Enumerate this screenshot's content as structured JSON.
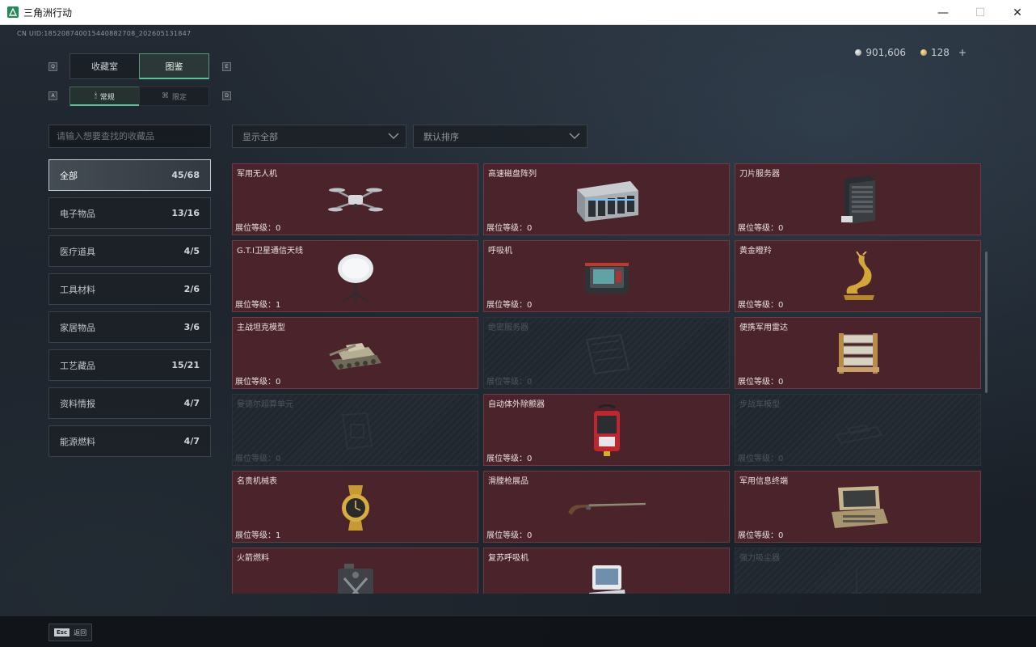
{
  "window": {
    "title": "三角洲行动",
    "minimize": "—",
    "maximize": "☐",
    "close": "✕"
  },
  "header": {
    "uid": "CN UID:18520874001544088270​8_202605131847",
    "silver": "901,606",
    "gold": "128",
    "plus": "+"
  },
  "tabs": {
    "left_key": "Q",
    "right_key": "E",
    "items": [
      {
        "label": "收藏室",
        "active": false
      },
      {
        "label": "图鉴",
        "active": true
      }
    ]
  },
  "subtabs": {
    "left_key": "A",
    "right_key": "D",
    "items": [
      {
        "label": "常规",
        "active": true
      },
      {
        "label": "限定",
        "active": false
      }
    ]
  },
  "search": {
    "placeholder": "请输入想要查找的收藏品"
  },
  "filters": {
    "show": "显示全部",
    "sort": "默认排序"
  },
  "categories": [
    {
      "label": "全部",
      "count": "45/68",
      "active": true
    },
    {
      "label": "电子物品",
      "count": "13/16",
      "active": false
    },
    {
      "label": "医疗道具",
      "count": "4/5",
      "active": false
    },
    {
      "label": "工具材料",
      "count": "2/6",
      "active": false
    },
    {
      "label": "家居物品",
      "count": "3/6",
      "active": false
    },
    {
      "label": "工艺藏品",
      "count": "15/21",
      "active": false
    },
    {
      "label": "资料情报",
      "count": "4/7",
      "active": false
    },
    {
      "label": "能源燃料",
      "count": "4/7",
      "active": false
    }
  ],
  "items": [
    {
      "name": "军用无人机",
      "level": "展位等级：0",
      "locked": false,
      "icon": "drone-icon"
    },
    {
      "name": "高速磁盘阵列",
      "level": "展位等级：0",
      "locked": false,
      "icon": "disk-array-icon"
    },
    {
      "name": "刀片服务器",
      "level": "展位等级：0",
      "locked": false,
      "icon": "blade-server-icon"
    },
    {
      "name": "G.T.I卫星通信天线",
      "level": "展位等级：1",
      "locked": false,
      "icon": "satellite-dish-icon"
    },
    {
      "name": "呼吸机",
      "level": "展位等级：0",
      "locked": false,
      "icon": "ventilator-icon"
    },
    {
      "name": "黄金瞪羚",
      "level": "展位等级：0",
      "locked": false,
      "icon": "gold-gazelle-icon"
    },
    {
      "name": "主战坦克模型",
      "level": "展位等级：0",
      "locked": false,
      "icon": "tank-model-icon"
    },
    {
      "name": "绝密服务器",
      "level": "展位等级：0",
      "locked": true,
      "icon": "server-icon"
    },
    {
      "name": "便携军用雷达",
      "level": "展位等级：0",
      "locked": false,
      "icon": "radar-icon"
    },
    {
      "name": "曼德尔超算单元",
      "level": "展位等级：0",
      "locked": true,
      "icon": "compute-unit-icon"
    },
    {
      "name": "自动体外除颤器",
      "level": "展位等级：0",
      "locked": false,
      "icon": "defibrillator-icon"
    },
    {
      "name": "步战车模型",
      "level": "展位等级：0",
      "locked": true,
      "icon": "ifv-model-icon"
    },
    {
      "name": "名贵机械表",
      "level": "展位等级：1",
      "locked": false,
      "icon": "watch-icon"
    },
    {
      "name": "滑膛枪展品",
      "level": "展位等级：0",
      "locked": false,
      "icon": "musket-icon"
    },
    {
      "name": "军用信息终端",
      "level": "展位等级：0",
      "locked": false,
      "icon": "terminal-icon"
    },
    {
      "name": "火箭燃料",
      "level": "",
      "locked": false,
      "icon": "fuel-can-icon"
    },
    {
      "name": "复苏呼吸机",
      "level": "",
      "locked": false,
      "icon": "resuscitator-icon"
    },
    {
      "name": "强力吸尘器",
      "level": "",
      "locked": true,
      "icon": "vacuum-icon"
    }
  ],
  "footer": {
    "esc_key": "Esc",
    "esc_label": "返回"
  }
}
